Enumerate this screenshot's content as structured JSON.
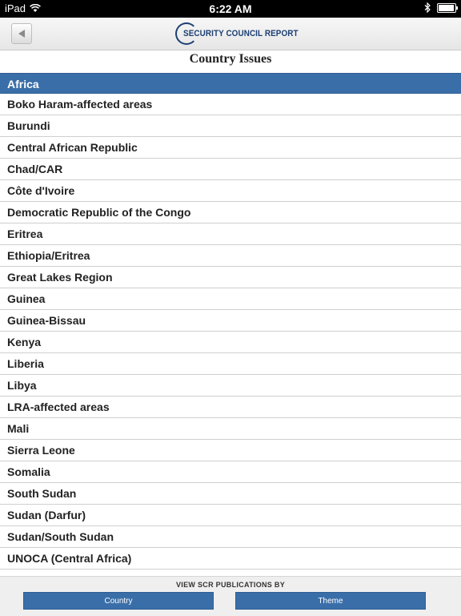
{
  "status_bar": {
    "carrier": "iPad",
    "time": "6:22 AM",
    "icons": [
      "wifi-icon",
      "bluetooth-icon",
      "battery-icon"
    ]
  },
  "header": {
    "logo_text": "SECURITY COUNCIL REPORT",
    "back_icon": "back-arrow-icon"
  },
  "page": {
    "title": "Country Issues"
  },
  "list": {
    "section": "Africa",
    "items": [
      "Boko Haram-affected areas",
      "Burundi",
      "Central African Republic",
      "Chad/CAR",
      "Côte d'Ivoire",
      "Democratic Republic of the Congo",
      "Eritrea",
      "Ethiopia/Eritrea",
      "Great Lakes Region",
      "Guinea",
      "Guinea-Bissau",
      "Kenya",
      "Liberia",
      "Libya",
      "LRA-affected areas",
      "Mali",
      "Sierra Leone",
      "Somalia",
      "South Sudan",
      "Sudan (Darfur)",
      "Sudan/South Sudan",
      "UNOCA (Central Africa)"
    ]
  },
  "footer": {
    "label": "VIEW SCR PUBLICATIONS BY",
    "country_button": "Country",
    "theme_button": "Theme"
  },
  "colors": {
    "accent": "#3a6ea8",
    "logo": "#1b3f73"
  }
}
